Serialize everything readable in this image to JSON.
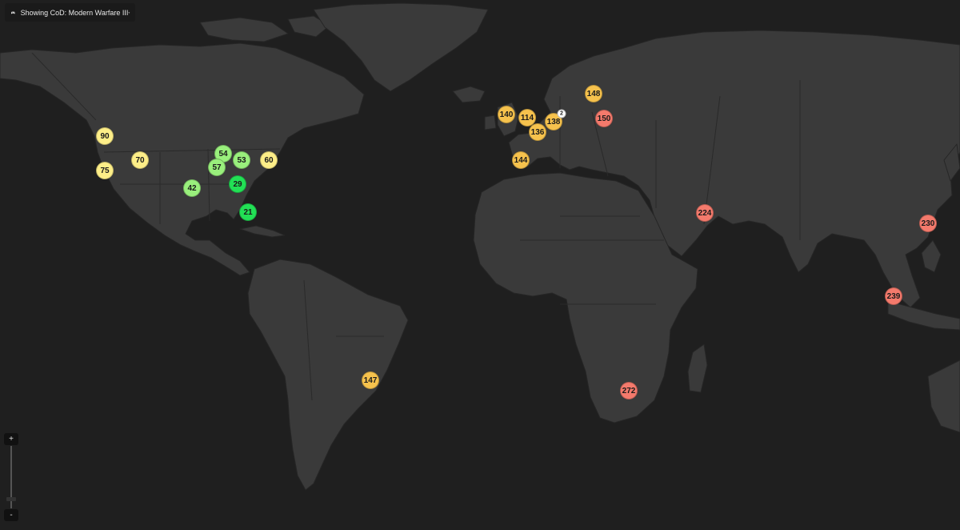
{
  "selector": {
    "label": "Showing CoD: Modern Warfare III",
    "icon": "gamepad-icon",
    "caret_icon": "caret-down-icon"
  },
  "zoom": {
    "in_label": "+",
    "out_label": "-",
    "level": 0.15
  },
  "colors": {
    "background": "#1f1f1f",
    "land": "#3a3a3a",
    "latency_low": "#22e055",
    "latency_good": "#99ef7c",
    "latency_mid": "#fdee88",
    "latency_high": "#f6c24d",
    "latency_very_high": "#f47a6c",
    "cluster": "#ffffff"
  },
  "servers": [
    {
      "id": "us-west-1",
      "value": "90",
      "level": "mid"
    },
    {
      "id": "us-west-2",
      "value": "75",
      "level": "mid"
    },
    {
      "id": "us-mountain",
      "value": "70",
      "level": "mid"
    },
    {
      "id": "us-central-1",
      "value": "54",
      "level": "good"
    },
    {
      "id": "us-central-2",
      "value": "57",
      "level": "good"
    },
    {
      "id": "us-east-1",
      "value": "53",
      "level": "good"
    },
    {
      "id": "us-east-2",
      "value": "60",
      "level": "mid"
    },
    {
      "id": "us-south",
      "value": "42",
      "level": "good"
    },
    {
      "id": "us-southeast",
      "value": "29",
      "level": "low"
    },
    {
      "id": "us-florida",
      "value": "21",
      "level": "low"
    },
    {
      "id": "eu-uk",
      "value": "140",
      "level": "high"
    },
    {
      "id": "eu-be",
      "value": "114",
      "level": "high"
    },
    {
      "id": "eu-de",
      "value": "138",
      "level": "high"
    },
    {
      "id": "eu-cluster",
      "value": "2",
      "level": "cluster"
    },
    {
      "id": "eu-fr",
      "value": "136",
      "level": "high"
    },
    {
      "id": "eu-se",
      "value": "148",
      "level": "high"
    },
    {
      "id": "eu-pl",
      "value": "150",
      "level": "very_high"
    },
    {
      "id": "eu-es",
      "value": "144",
      "level": "high"
    },
    {
      "id": "me-uae",
      "value": "224",
      "level": "very_high"
    },
    {
      "id": "as-hk",
      "value": "230",
      "level": "very_high"
    },
    {
      "id": "as-sg",
      "value": "239",
      "level": "very_high"
    },
    {
      "id": "af-za",
      "value": "272",
      "level": "very_high"
    },
    {
      "id": "sa-br",
      "value": "147",
      "level": "high"
    }
  ]
}
